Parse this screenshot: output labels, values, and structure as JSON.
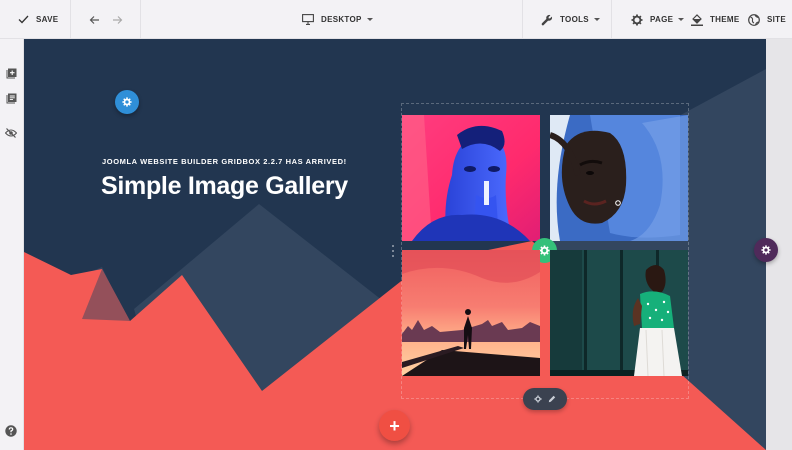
{
  "toolbar": {
    "save_label": "SAVE",
    "device_label": "DESKTOP",
    "tools_label": "TOOLS",
    "page_label": "PAGE",
    "theme_label": "THEME",
    "site_label": "SITE"
  },
  "hero": {
    "subtitle": "JOOMLA WEBSITE BUILDER GRIDBOX 2.2.7 HAS ARRIVED!",
    "title": "Simple Image Gallery"
  },
  "fab_symbol": "+",
  "colors": {
    "canvas_bg": "#223650",
    "mountain_dark": "#33465f",
    "coral": "#f45a55",
    "gear_blue": "#2f8fd8",
    "gear_green": "#34c07a",
    "gear_purple": "#4f2a5a",
    "fab_red": "#f04f43"
  },
  "icons": {
    "save": "check-icon",
    "undo": "arrow-left-icon",
    "redo": "arrow-right-icon",
    "device": "monitor-icon",
    "tools": "wrench-icon",
    "page": "gear-icon",
    "theme": "paint-bucket-icon",
    "site": "globe-icon",
    "sidebar": [
      "add-section-icon",
      "library-icon",
      "visibility-off-icon",
      "help-icon"
    ]
  },
  "gallery": {
    "images": [
      "blue-neon-portrait",
      "woman-hood-portrait",
      "pier-sunset",
      "woman-green-blouse"
    ]
  }
}
